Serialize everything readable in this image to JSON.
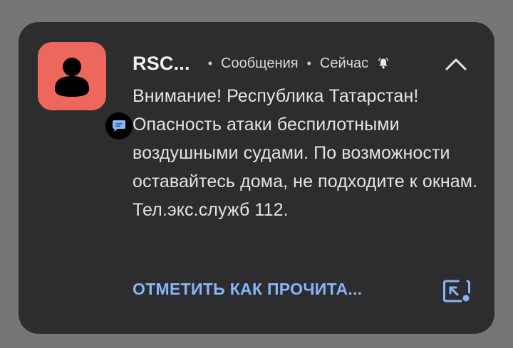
{
  "notification": {
    "sender": "RSC...",
    "app_name": "Сообщения",
    "time": "Сейчас",
    "separator": "•",
    "message": "Внимание! Республика Татарстан! Опасность атаки беспилотными воздушными судами. По возможности оставайтесь дома, не подходите к окнам. Тел.экс.служб 112.",
    "action_label": "ОТМЕТИТЬ КАК ПРОЧИТА...",
    "icons": {
      "avatar": "person-icon",
      "app_badge": "messages-app-icon",
      "alert": "bell-alert-icon",
      "expand": "chevron-up-icon",
      "action": "open-screen-icon"
    },
    "colors": {
      "background": "#767676",
      "card": "#2d2d2f",
      "avatar": "#ee675c",
      "accent": "#8ab4f8",
      "text": "#e3e3e3"
    }
  }
}
